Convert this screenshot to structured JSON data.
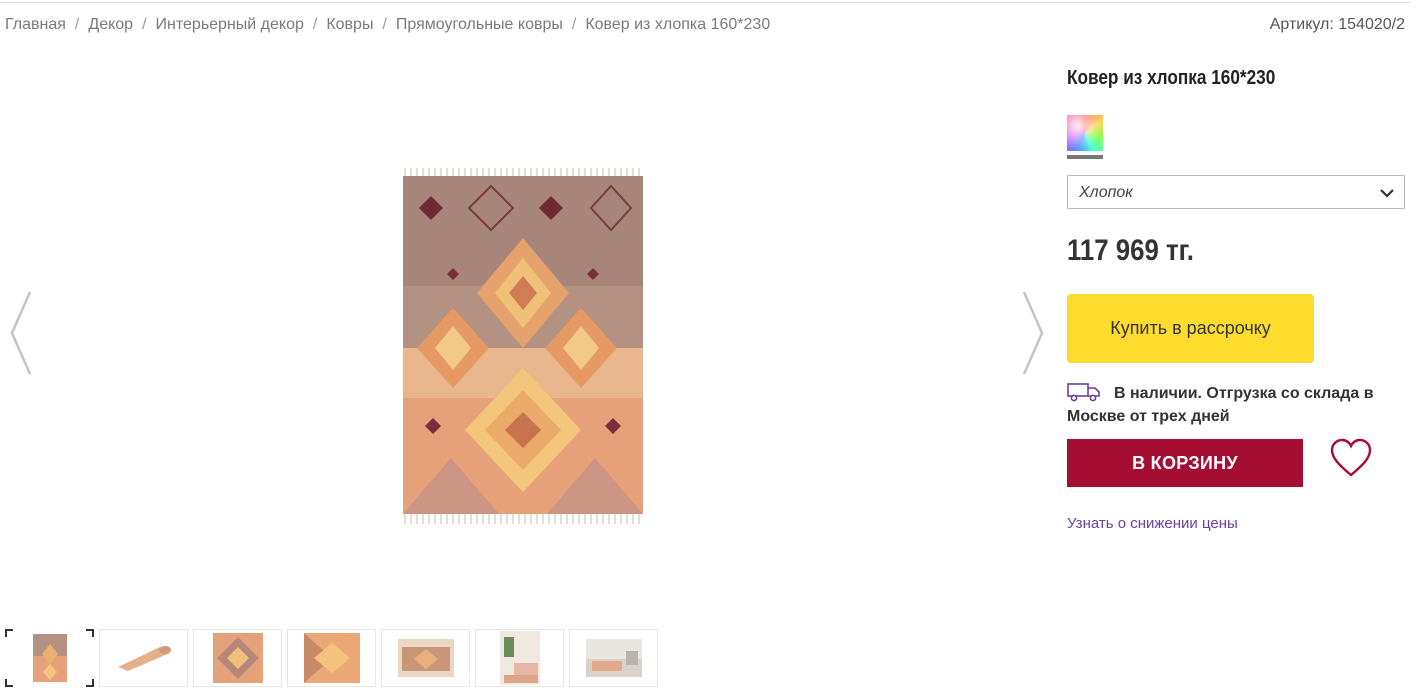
{
  "breadcrumb": {
    "items": [
      "Главная",
      "Декор",
      "Интерьерный декор",
      "Ковры",
      "Прямоугольные ковры",
      "Ковер из хлопка 160*230"
    ],
    "separator": "/"
  },
  "sku": "Артикул: 154020/2",
  "product": {
    "title": "Ковер из хлопка 160*230",
    "color_swatch": "multicolor",
    "material_select": {
      "value": "Хлопок"
    },
    "price": "117 969 тг.",
    "installment_label": "Купить в рассрочку",
    "stock_text": "В наличии. Отгрузка со склада в Москве от трех дней",
    "cart_label": "В КОРЗИНУ",
    "price_alert_label": "Узнать о снижении цены"
  },
  "gallery": {
    "thumbnail_count": 7,
    "active_index": 0
  },
  "colors": {
    "installment_button": "#fedc2d",
    "cart_button": "#a60d33",
    "heart": "#a60d33",
    "link": "#6b3fa0"
  },
  "icons": [
    "chevron-left-icon",
    "chevron-right-icon",
    "chevron-down-icon",
    "truck-icon",
    "heart-icon"
  ]
}
